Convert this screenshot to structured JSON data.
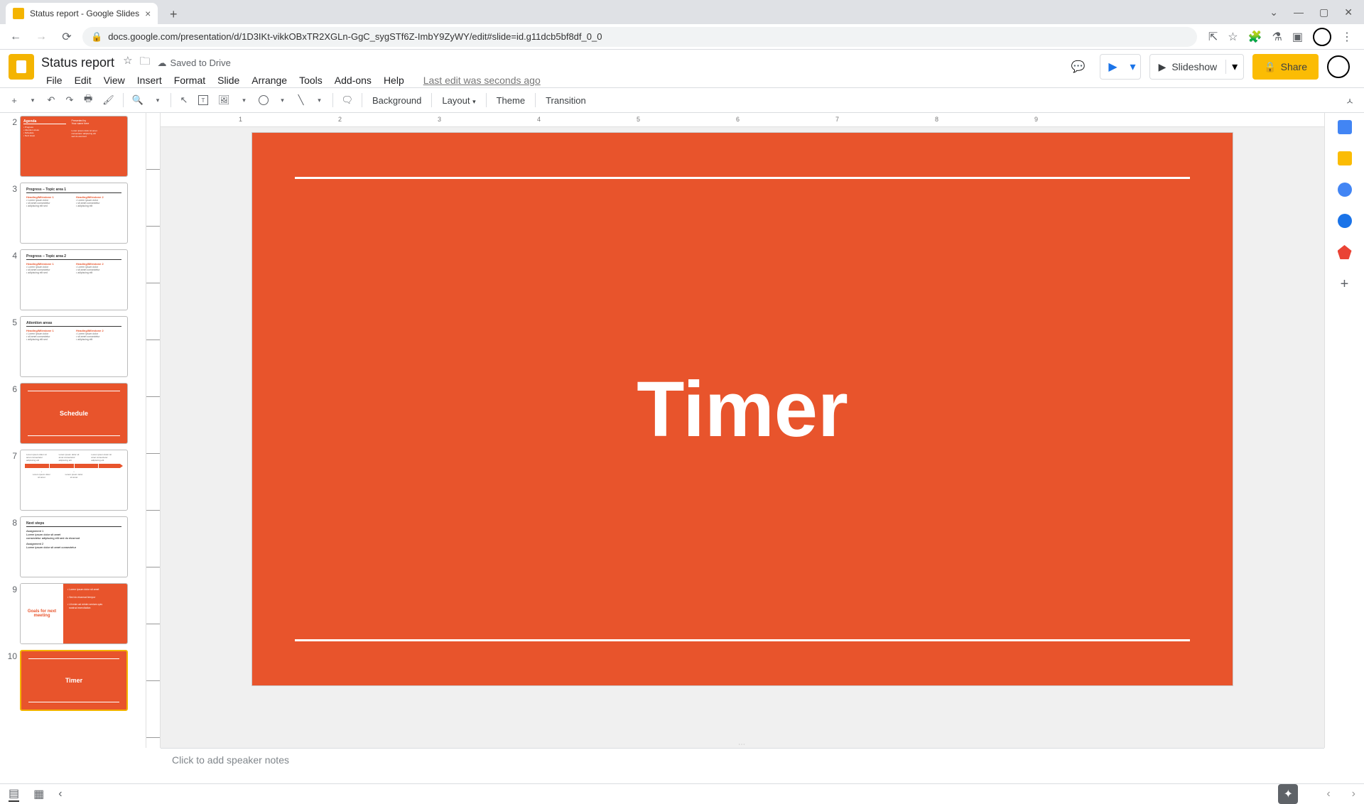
{
  "browser": {
    "tab_title": "Status report - Google Slides",
    "url": "docs.google.com/presentation/d/1D3IKt-vikkOBxTR2XGLn-GgC_sygSTf6Z-ImbY9ZyWY/edit#slide=id.g11dcb5bf8df_0_0"
  },
  "app": {
    "doc_title": "Status report",
    "saved_status": "Saved to Drive",
    "last_edit": "Last edit was seconds ago",
    "menus": [
      "File",
      "Edit",
      "View",
      "Insert",
      "Format",
      "Slide",
      "Arrange",
      "Tools",
      "Add-ons",
      "Help"
    ],
    "slideshow_label": "Slideshow",
    "share_label": "Share"
  },
  "toolbar": {
    "background": "Background",
    "layout": "Layout",
    "theme": "Theme",
    "transition": "Transition"
  },
  "ruler_marks": [
    "1",
    "2",
    "3",
    "4",
    "5",
    "6",
    "7",
    "8",
    "9"
  ],
  "slide": {
    "title": "Timer"
  },
  "notes": {
    "placeholder": "Click to add speaker notes"
  },
  "thumbs": [
    {
      "num": "2",
      "type": "content-orange-right"
    },
    {
      "num": "3",
      "type": "two-col",
      "heading": "Progress – Topic area 1"
    },
    {
      "num": "4",
      "type": "two-col",
      "heading": "Progress – Topic area 2"
    },
    {
      "num": "5",
      "type": "two-col",
      "heading": "Attention areas"
    },
    {
      "num": "6",
      "type": "orange-title",
      "title": "Schedule"
    },
    {
      "num": "7",
      "type": "timeline"
    },
    {
      "num": "8",
      "type": "single-col",
      "heading": "Next steps"
    },
    {
      "num": "9",
      "type": "split",
      "left": "Goals for next meeting"
    },
    {
      "num": "10",
      "type": "orange-title",
      "title": "Timer",
      "selected": true
    }
  ]
}
